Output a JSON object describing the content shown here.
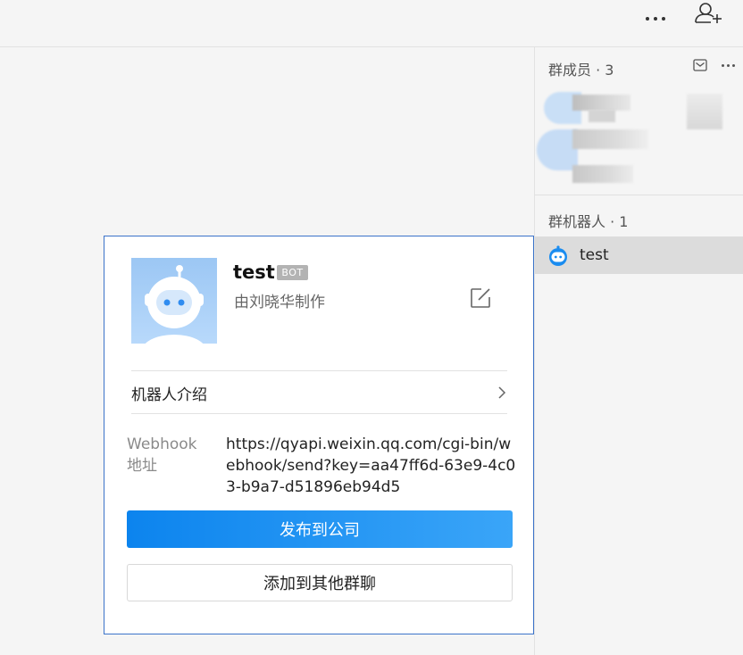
{
  "topbar": {
    "more_icon": "more-horizontal-icon",
    "add_member_icon": "add-member-icon"
  },
  "side_panel": {
    "members_title": "群成员 · 3",
    "robots_title": "群机器人 · 1",
    "robot_item": {
      "name": "test",
      "icon": "robot-icon"
    }
  },
  "card": {
    "bot_name": "test",
    "badge": "BOT",
    "maker": "由刘晓华制作",
    "intro_label": "机器人介绍",
    "webhook_label": "Webhook 地址",
    "webhook_url": "https://qyapi.weixin.qq.com/cgi-bin/webhook/send?key=aa47ff6d-63e9-4c03-b9a7-d51896eb94d5",
    "publish_button": "发布到公司",
    "add_group_button": "添加到其他群聊"
  },
  "colors": {
    "accent": "#1a8cf0",
    "card_border": "#3b73c9",
    "badge_bg": "#b3b3b3"
  }
}
